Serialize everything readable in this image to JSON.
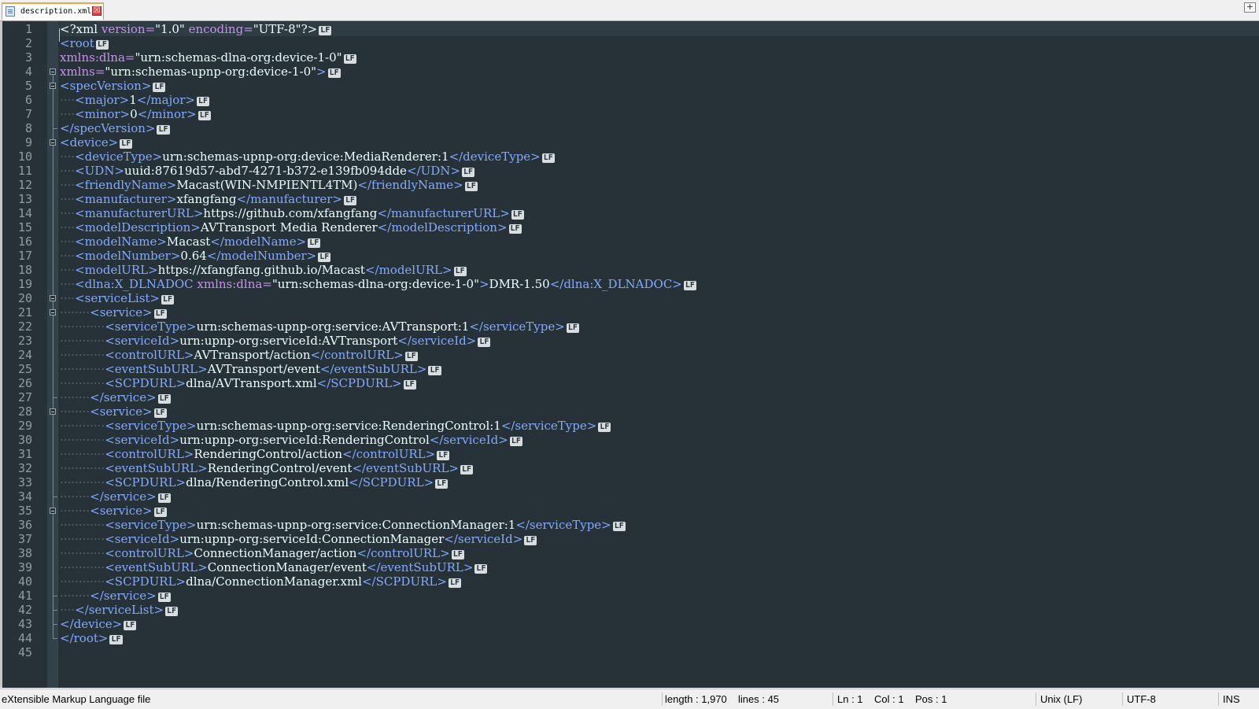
{
  "tab": {
    "label": "description.xml",
    "close": "☒"
  },
  "window": {
    "restore_label": "+"
  },
  "editor": {
    "lines": [
      [
        [
          "pi",
          "<?xml "
        ],
        [
          "attr",
          "version="
        ],
        [
          "val",
          "\"1.0\" "
        ],
        [
          "attr",
          "encoding="
        ],
        [
          "val",
          "\"UTF-8\""
        ],
        [
          "pi",
          "?>"
        ]
      ],
      [
        [
          "tag",
          "<root"
        ]
      ],
      [
        [
          "attr",
          "xmlns:dlna="
        ],
        [
          "val",
          "\"urn:schemas-dlna-org:device-1-0\""
        ]
      ],
      [
        [
          "attr",
          "xmlns="
        ],
        [
          "val",
          "\"urn:schemas-upnp-org:device-1-0\""
        ],
        [
          "tag",
          ">"
        ]
      ],
      [
        [
          "tag",
          "<specVersion>"
        ]
      ],
      [
        [
          "ws",
          "····"
        ],
        [
          "tag",
          "<major>"
        ],
        [
          "text",
          "1"
        ],
        [
          "tag",
          "</major>"
        ]
      ],
      [
        [
          "ws",
          "····"
        ],
        [
          "tag",
          "<minor>"
        ],
        [
          "text",
          "0"
        ],
        [
          "tag",
          "</minor>"
        ]
      ],
      [
        [
          "tag",
          "</specVersion>"
        ]
      ],
      [
        [
          "tag",
          "<device>"
        ]
      ],
      [
        [
          "ws",
          "····"
        ],
        [
          "tag",
          "<deviceType>"
        ],
        [
          "text",
          "urn:schemas-upnp-org:device:MediaRenderer:1"
        ],
        [
          "tag",
          "</deviceType>"
        ]
      ],
      [
        [
          "ws",
          "····"
        ],
        [
          "tag",
          "<UDN>"
        ],
        [
          "text",
          "uuid:87619d57-abd7-4271-b372-e139fb094dde"
        ],
        [
          "tag",
          "</UDN>"
        ]
      ],
      [
        [
          "ws",
          "····"
        ],
        [
          "tag",
          "<friendlyName>"
        ],
        [
          "text",
          "Macast(WIN-NMPIENTL4TM)"
        ],
        [
          "tag",
          "</friendlyName>"
        ]
      ],
      [
        [
          "ws",
          "····"
        ],
        [
          "tag",
          "<manufacturer>"
        ],
        [
          "text",
          "xfangfang"
        ],
        [
          "tag",
          "</manufacturer>"
        ]
      ],
      [
        [
          "ws",
          "····"
        ],
        [
          "tag",
          "<manufacturerURL>"
        ],
        [
          "text",
          "https://github.com/xfangfang"
        ],
        [
          "tag",
          "</manufacturerURL>"
        ]
      ],
      [
        [
          "ws",
          "····"
        ],
        [
          "tag",
          "<modelDescription>"
        ],
        [
          "text",
          "AVTransport Media Renderer"
        ],
        [
          "tag",
          "</modelDescription>"
        ]
      ],
      [
        [
          "ws",
          "····"
        ],
        [
          "tag",
          "<modelName>"
        ],
        [
          "text",
          "Macast"
        ],
        [
          "tag",
          "</modelName>"
        ]
      ],
      [
        [
          "ws",
          "····"
        ],
        [
          "tag",
          "<modelNumber>"
        ],
        [
          "text",
          "0.64"
        ],
        [
          "tag",
          "</modelNumber>"
        ]
      ],
      [
        [
          "ws",
          "····"
        ],
        [
          "tag",
          "<modelURL>"
        ],
        [
          "text",
          "https://xfangfang.github.io/Macast"
        ],
        [
          "tag",
          "</modelURL>"
        ]
      ],
      [
        [
          "ws",
          "····"
        ],
        [
          "tag",
          "<dlna:X_DLNADOC "
        ],
        [
          "attr",
          "xmlns:dlna="
        ],
        [
          "val",
          "\"urn:schemas-dlna-org:device-1-0\""
        ],
        [
          "tag",
          ">"
        ],
        [
          "text",
          "DMR-1.50"
        ],
        [
          "tag",
          "</dlna:X_DLNADOC>"
        ]
      ],
      [
        [
          "ws",
          "····"
        ],
        [
          "tag",
          "<serviceList>"
        ]
      ],
      [
        [
          "ws",
          "········"
        ],
        [
          "tag",
          "<service>"
        ]
      ],
      [
        [
          "ws",
          "············"
        ],
        [
          "tag",
          "<serviceType>"
        ],
        [
          "text",
          "urn:schemas-upnp-org:service:AVTransport:1"
        ],
        [
          "tag",
          "</serviceType>"
        ]
      ],
      [
        [
          "ws",
          "············"
        ],
        [
          "tag",
          "<serviceId>"
        ],
        [
          "text",
          "urn:upnp-org:serviceId:AVTransport"
        ],
        [
          "tag",
          "</serviceId>"
        ]
      ],
      [
        [
          "ws",
          "············"
        ],
        [
          "tag",
          "<controlURL>"
        ],
        [
          "text",
          "AVTransport/action"
        ],
        [
          "tag",
          "</controlURL>"
        ]
      ],
      [
        [
          "ws",
          "············"
        ],
        [
          "tag",
          "<eventSubURL>"
        ],
        [
          "text",
          "AVTransport/event"
        ],
        [
          "tag",
          "</eventSubURL>"
        ]
      ],
      [
        [
          "ws",
          "············"
        ],
        [
          "tag",
          "<SCPDURL>"
        ],
        [
          "text",
          "dlna/AVTransport.xml"
        ],
        [
          "tag",
          "</SCPDURL>"
        ]
      ],
      [
        [
          "ws",
          "········"
        ],
        [
          "tag",
          "</service>"
        ]
      ],
      [
        [
          "ws",
          "········"
        ],
        [
          "tag",
          "<service>"
        ]
      ],
      [
        [
          "ws",
          "············"
        ],
        [
          "tag",
          "<serviceType>"
        ],
        [
          "text",
          "urn:schemas-upnp-org:service:RenderingControl:1"
        ],
        [
          "tag",
          "</serviceType>"
        ]
      ],
      [
        [
          "ws",
          "············"
        ],
        [
          "tag",
          "<serviceId>"
        ],
        [
          "text",
          "urn:upnp-org:serviceId:RenderingControl"
        ],
        [
          "tag",
          "</serviceId>"
        ]
      ],
      [
        [
          "ws",
          "············"
        ],
        [
          "tag",
          "<controlURL>"
        ],
        [
          "text",
          "RenderingControl/action"
        ],
        [
          "tag",
          "</controlURL>"
        ]
      ],
      [
        [
          "ws",
          "············"
        ],
        [
          "tag",
          "<eventSubURL>"
        ],
        [
          "text",
          "RenderingControl/event"
        ],
        [
          "tag",
          "</eventSubURL>"
        ]
      ],
      [
        [
          "ws",
          "············"
        ],
        [
          "tag",
          "<SCPDURL>"
        ],
        [
          "text",
          "dlna/RenderingControl.xml"
        ],
        [
          "tag",
          "</SCPDURL>"
        ]
      ],
      [
        [
          "ws",
          "········"
        ],
        [
          "tag",
          "</service>"
        ]
      ],
      [
        [
          "ws",
          "········"
        ],
        [
          "tag",
          "<service>"
        ]
      ],
      [
        [
          "ws",
          "············"
        ],
        [
          "tag",
          "<serviceType>"
        ],
        [
          "text",
          "urn:schemas-upnp-org:service:ConnectionManager:1"
        ],
        [
          "tag",
          "</serviceType>"
        ]
      ],
      [
        [
          "ws",
          "············"
        ],
        [
          "tag",
          "<serviceId>"
        ],
        [
          "text",
          "urn:upnp-org:serviceId:ConnectionManager"
        ],
        [
          "tag",
          "</serviceId>"
        ]
      ],
      [
        [
          "ws",
          "············"
        ],
        [
          "tag",
          "<controlURL>"
        ],
        [
          "text",
          "ConnectionManager/action"
        ],
        [
          "tag",
          "</controlURL>"
        ]
      ],
      [
        [
          "ws",
          "············"
        ],
        [
          "tag",
          "<eventSubURL>"
        ],
        [
          "text",
          "ConnectionManager/event"
        ],
        [
          "tag",
          "</eventSubURL>"
        ]
      ],
      [
        [
          "ws",
          "············"
        ],
        [
          "tag",
          "<SCPDURL>"
        ],
        [
          "text",
          "dlna/ConnectionManager.xml"
        ],
        [
          "tag",
          "</SCPDURL>"
        ]
      ],
      [
        [
          "ws",
          "········"
        ],
        [
          "tag",
          "</service>"
        ]
      ],
      [
        [
          "ws",
          "····"
        ],
        [
          "tag",
          "</serviceList>"
        ]
      ],
      [
        [
          "tag",
          "</device>"
        ]
      ],
      [
        [
          "tag",
          "</root>"
        ]
      ],
      []
    ],
    "eol_marker": "LF"
  },
  "statusbar": {
    "file_type": "eXtensible Markup Language file",
    "length": "length : 1,970",
    "lines": "lines : 45",
    "ln": "Ln : 1",
    "col": "Col : 1",
    "pos": "Pos : 1",
    "eol": "Unix (LF)",
    "encoding": "UTF-8",
    "mode": "INS"
  }
}
